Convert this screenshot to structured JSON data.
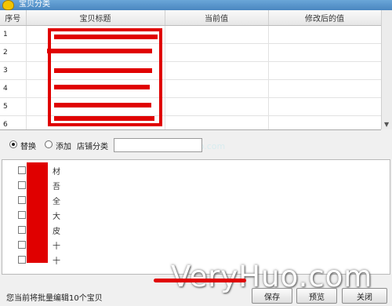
{
  "window": {
    "title": "宝贝分类"
  },
  "grid": {
    "columns": [
      "序号",
      "宝贝标题",
      "当前值",
      "修改后的值"
    ],
    "rows": [
      {
        "index": "1",
        "title": "",
        "current": "",
        "modified": ""
      },
      {
        "index": "2",
        "title": "",
        "current": "",
        "modified": ""
      },
      {
        "index": "3",
        "title": "",
        "current": "",
        "modified": ""
      },
      {
        "index": "4",
        "title": "",
        "current": "",
        "modified": ""
      },
      {
        "index": "5",
        "title": "",
        "current": "",
        "modified": ""
      },
      {
        "index": "6",
        "title": "",
        "current": "",
        "modified": ""
      }
    ]
  },
  "mode": {
    "replace_label": "替换",
    "add_label": "添加",
    "selected": "替换",
    "shop_category_label": "店铺分类",
    "shop_category_value": ""
  },
  "categories": [
    {
      "label": "材",
      "checked": false
    },
    {
      "label": "吾",
      "checked": false
    },
    {
      "label": "全",
      "checked": false
    },
    {
      "label": "大",
      "checked": false
    },
    {
      "label": "皮",
      "checked": false
    },
    {
      "label": "十",
      "checked": false
    },
    {
      "label": "十",
      "checked": false
    }
  ],
  "status": {
    "text": "您当前将批量编辑10个宝贝"
  },
  "buttons": {
    "save": "保存",
    "preview": "预览",
    "close": "关闭"
  },
  "watermark": {
    "text": "VeryHuo.com",
    "url": "www.veryhuo.com"
  },
  "colors": {
    "redaction": "#e00000",
    "titlebar": "#4a86c0"
  }
}
